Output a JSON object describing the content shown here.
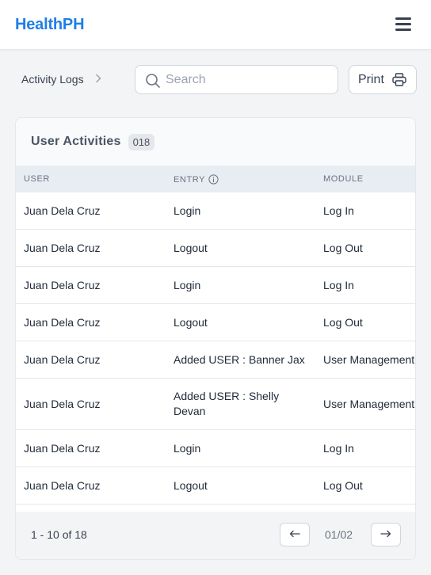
{
  "app": {
    "brand": "HealthPH"
  },
  "breadcrumb": {
    "current": "Activity Logs"
  },
  "search": {
    "placeholder": "Search",
    "value": ""
  },
  "toolbar": {
    "print_label": "Print"
  },
  "card": {
    "title": "User Activities",
    "count": "018"
  },
  "table": {
    "columns": [
      {
        "label": "USER"
      },
      {
        "label": "ENTRY"
      },
      {
        "label": "MODULE"
      }
    ],
    "rows": [
      {
        "user": "Juan Dela Cruz",
        "entry": "Login",
        "module": "Log In"
      },
      {
        "user": "Juan Dela Cruz",
        "entry": "Logout",
        "module": "Log Out"
      },
      {
        "user": "Juan Dela Cruz",
        "entry": "Login",
        "module": "Log In"
      },
      {
        "user": "Juan Dela Cruz",
        "entry": "Logout",
        "module": "Log Out"
      },
      {
        "user": "Juan Dela Cruz",
        "entry": "Added USER : Banner Jax",
        "module": "User Management"
      },
      {
        "user": "Juan Dela Cruz",
        "entry": "Added USER : Shelly Devan",
        "module": "User Management"
      },
      {
        "user": "Juan Dela Cruz",
        "entry": "Login",
        "module": "Log In"
      },
      {
        "user": "Juan Dela Cruz",
        "entry": "Logout",
        "module": "Log Out"
      }
    ]
  },
  "pagination": {
    "range_text": "1 - 10 of 18",
    "current_page": "01",
    "total_pages": "02"
  },
  "icons": {
    "menu": "hamburger-menu-icon",
    "breadcrumb_sep": "chevron-right-icon",
    "search": "search-icon",
    "print": "printer-icon",
    "entry_info": "info-icon",
    "prev": "arrow-left-icon",
    "next": "arrow-right-icon"
  },
  "colors": {
    "brand": "#1d7fe8",
    "header_row": "#e8edf4",
    "border": "#e5e7eb"
  }
}
